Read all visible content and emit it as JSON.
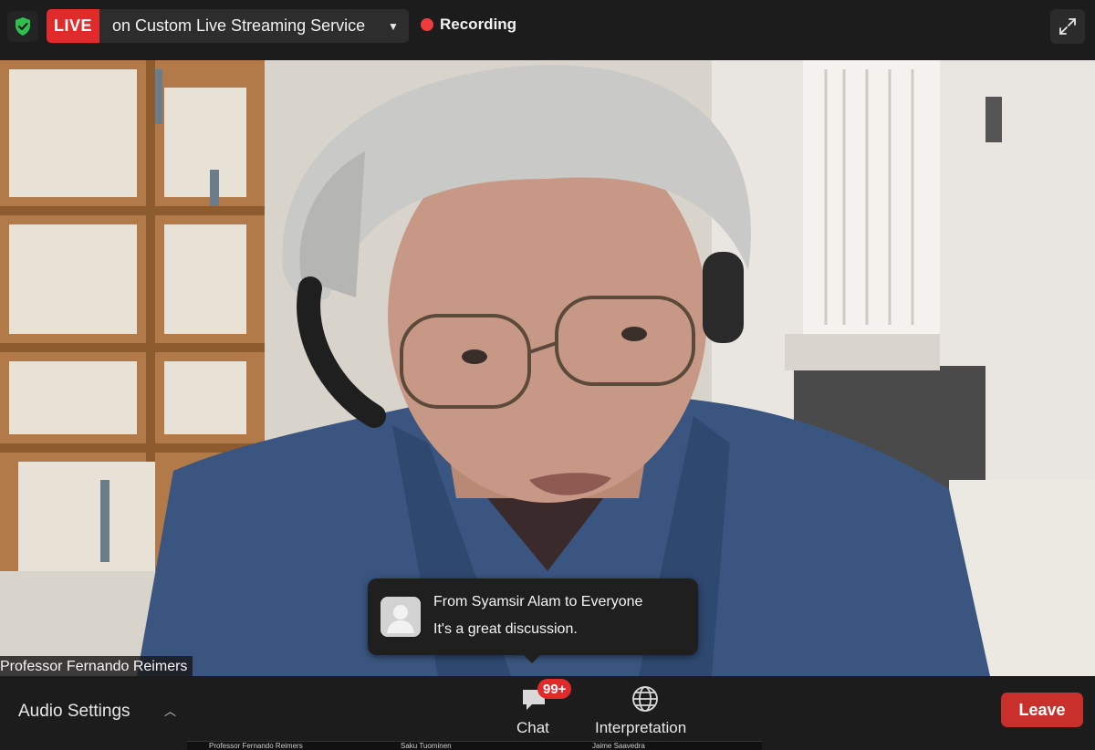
{
  "topbar": {
    "live_badge": "LIVE",
    "live_service": "on Custom Live Streaming Service",
    "recording": "Recording"
  },
  "video": {
    "participant_name": "Professor Fernando Reimers"
  },
  "chat_toast": {
    "from": "From Syamsir Alam to Everyone",
    "message": "It's a great discussion."
  },
  "bottombar": {
    "audio_settings": "Audio Settings",
    "chat_label": "Chat",
    "chat_badge": "99+",
    "interpretation_label": "Interpretation",
    "leave_label": "Leave"
  },
  "gallery_strip": [
    "Professor Fernando Reimers",
    "Saku Tuominen",
    "Jaime Saavedra"
  ],
  "colors": {
    "live_red": "#e02b2b",
    "leave_red": "#c9302c",
    "security_green": "#2fbf4f",
    "bar_bg": "#1c1c1c"
  },
  "icons": [
    "shield-check-icon",
    "chevron-down-icon",
    "record-dot-icon",
    "fullscreen-icon",
    "chevron-up-icon",
    "chat-icon",
    "globe-icon",
    "avatar-icon"
  ]
}
